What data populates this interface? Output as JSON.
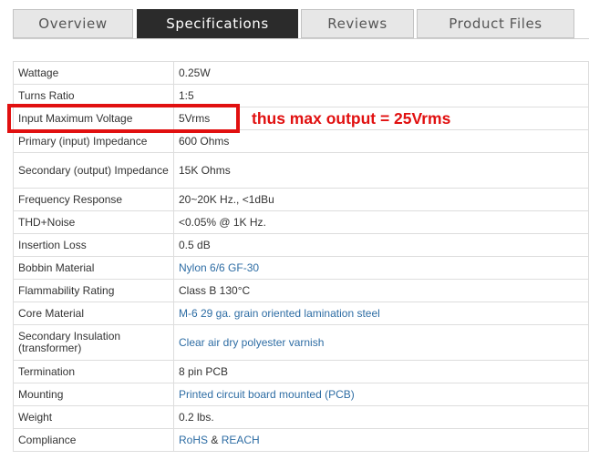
{
  "tabs": [
    {
      "label": "Overview"
    },
    {
      "label": "Specifications"
    },
    {
      "label": "Reviews"
    },
    {
      "label": "Product Files"
    }
  ],
  "specs": [
    {
      "label": "Wattage",
      "value": "0.25W"
    },
    {
      "label": "Turns Ratio",
      "value": "1:5"
    },
    {
      "label": "Input Maximum Voltage",
      "value": "5Vrms"
    },
    {
      "label": "Primary (input) Impedance",
      "value": "600 Ohms"
    },
    {
      "label": "Secondary (output) Impedance",
      "value": "15K Ohms"
    },
    {
      "label": "Frequency Response",
      "value": "20~20K Hz., <1dBu"
    },
    {
      "label": "THD+Noise",
      "value": "<0.05% @ 1K Hz."
    },
    {
      "label": "Insertion Loss",
      "value": "0.5 dB"
    },
    {
      "label": "Bobbin Material",
      "value": "Nylon 6/6 GF-30"
    },
    {
      "label": "Flammability Rating",
      "value": "Class B 130°C"
    },
    {
      "label": "Core Material",
      "value": "M-6 29 ga. grain oriented lamination steel"
    },
    {
      "label": "Secondary Insulation (transformer)",
      "value": "Clear air dry polyester varnish"
    },
    {
      "label": "Termination",
      "value": "8 pin PCB"
    },
    {
      "label": "Mounting",
      "value": "Printed circuit board mounted (PCB)"
    },
    {
      "label": "Weight",
      "value": "0.2 lbs."
    },
    {
      "label": "Compliance",
      "value_parts": [
        "RoHS",
        "&",
        "REACH"
      ]
    }
  ],
  "annotation": {
    "text": "thus max output = 25Vrms"
  },
  "colors": {
    "annotation": "#e11010",
    "link": "#2e6da4",
    "active_tab": "#2b2b2b",
    "tab": "#e7e7e7"
  }
}
